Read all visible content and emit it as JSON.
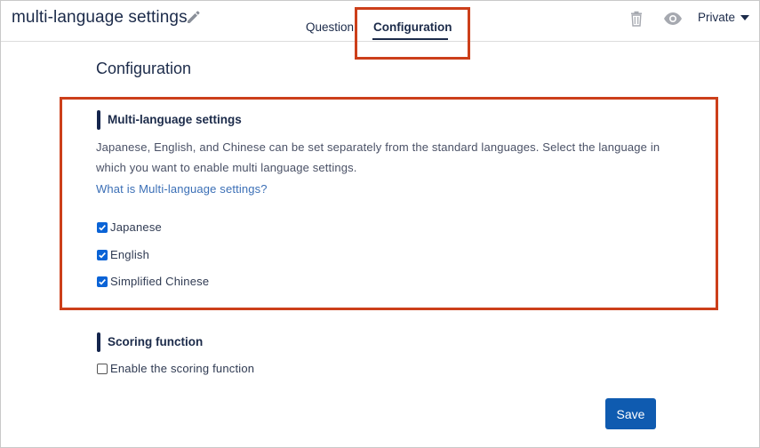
{
  "header": {
    "title": "multi-language settings",
    "tabs": [
      {
        "label": "Question"
      },
      {
        "label": "Configuration",
        "active": true
      }
    ],
    "visibility": "Private"
  },
  "page": {
    "title": "Configuration"
  },
  "multi_language": {
    "section_title": "Multi-language settings",
    "description": "Japanese, English, and Chinese can be set separately from the standard languages. Select the language in which you want to enable multi language settings.",
    "help_link": "What is Multi-language settings?",
    "options": [
      {
        "label": "Japanese",
        "checked": true
      },
      {
        "label": "English",
        "checked": true
      },
      {
        "label": "Simplified Chinese",
        "checked": true
      }
    ]
  },
  "scoring": {
    "section_title": "Scoring function",
    "option_label": "Enable the scoring function",
    "checked": false
  },
  "actions": {
    "save_label": "Save"
  },
  "colors": {
    "accent": "#0f5bb0",
    "highlight": "#cc3f1a",
    "text": "#1c2b4a",
    "link": "#3b6fb6"
  }
}
